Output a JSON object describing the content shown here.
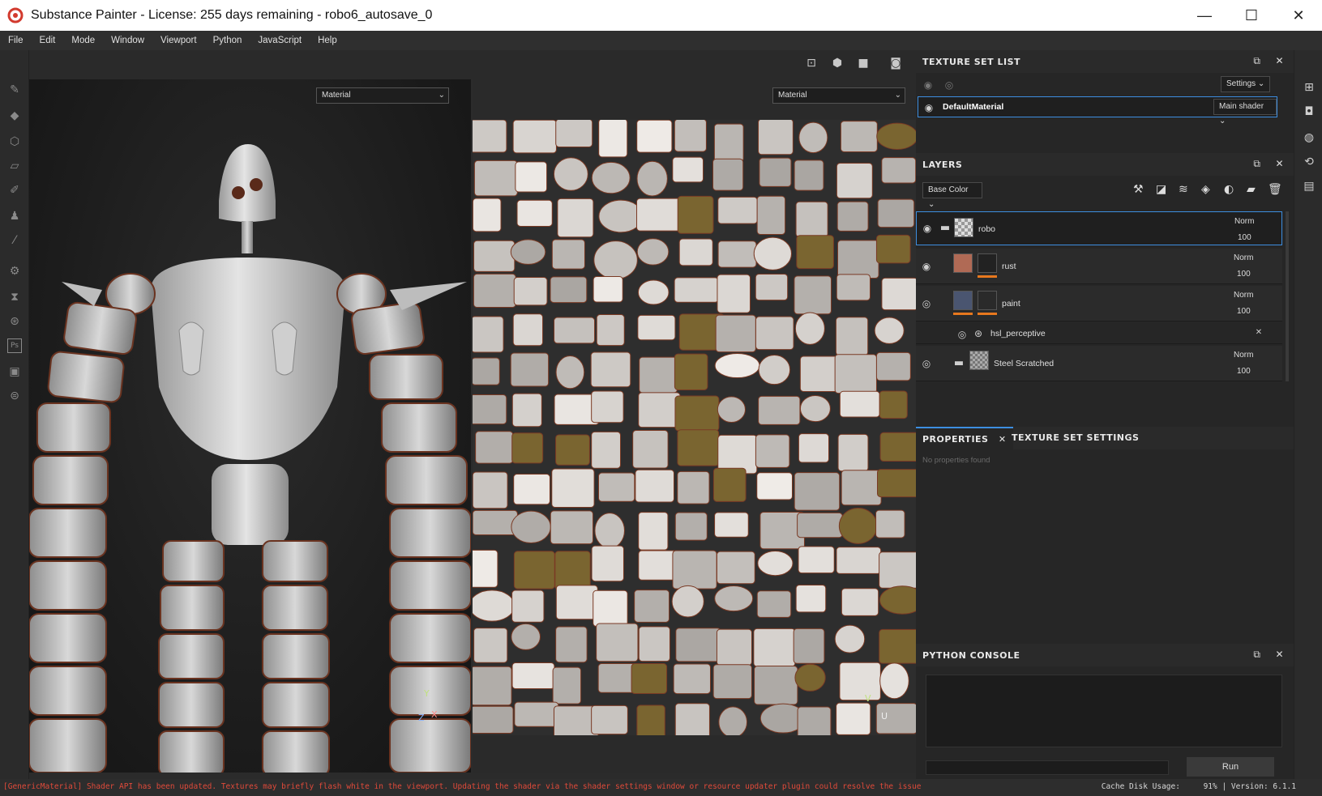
{
  "window": {
    "title": "Substance Painter - License: 255 days remaining - robo6_autosave_0",
    "minimize_glyph": "—",
    "maximize_glyph": "☐",
    "close_glyph": "✕"
  },
  "menu": {
    "items": [
      "File",
      "Edit",
      "Mode",
      "Window",
      "Viewport",
      "Python",
      "JavaScript",
      "Help"
    ]
  },
  "viewport": {
    "left_material": "Material",
    "right_material": "Material",
    "axis_y": "Y",
    "axis_z": "Z",
    "axis_x": "X",
    "uv_axis_v": "V",
    "uv_axis_u": "U"
  },
  "texture_set_list": {
    "title": "TEXTURE SET LIST",
    "settings_label": "Settings",
    "material_name": "DefaultMaterial",
    "shader_label": "Main shader"
  },
  "layers": {
    "title": "LAYERS",
    "channel": "Base Color",
    "rows": [
      {
        "name": "robo",
        "blend": "Norm",
        "opacity": "100"
      },
      {
        "name": "rust",
        "blend": "Norm",
        "opacity": "100"
      },
      {
        "name": "paint",
        "blend": "Norm",
        "opacity": "100"
      },
      {
        "name": "hsl_perceptive",
        "blend": "",
        "opacity": ""
      },
      {
        "name": "Steel Scratched",
        "blend": "Norm",
        "opacity": "100"
      }
    ]
  },
  "properties": {
    "tab_properties": "PROPERTIES",
    "tab_texture_set_settings": "TEXTURE SET SETTINGS",
    "empty_text": "No properties found"
  },
  "python_console": {
    "title": "PYTHON CONSOLE",
    "run_label": "Run"
  },
  "status": {
    "message": "[GenericMaterial] Shader API has been updated. Textures may briefly flash white in the viewport. Updating the shader via the shader settings window or resource updater plugin could resolve the issue",
    "cache_label": "Cache Disk Usage:",
    "cache_value": "91%",
    "version": "| Version: 6.1.1"
  },
  "colors": {
    "accent_blue": "#3d8ee0",
    "orange_mask": "#e8781e",
    "status_red": "#e04a3a"
  }
}
